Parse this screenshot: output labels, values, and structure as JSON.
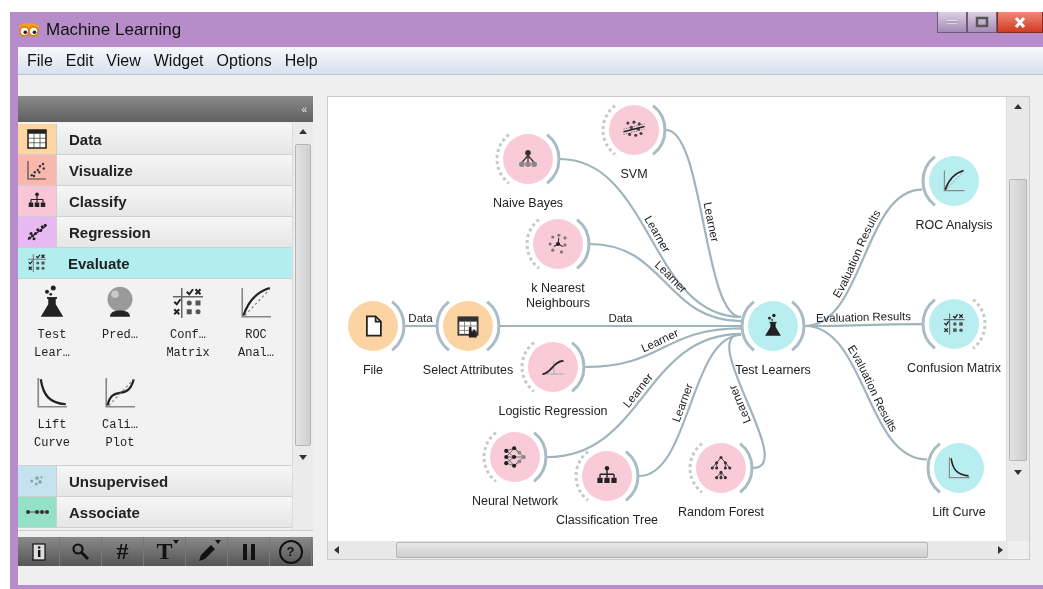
{
  "window": {
    "title": "Machine Learning"
  },
  "menu": [
    {
      "label": "File"
    },
    {
      "label": "Edit"
    },
    {
      "label": "View"
    },
    {
      "label": "Widget"
    },
    {
      "label": "Options"
    },
    {
      "label": "Help"
    }
  ],
  "toolbox": {
    "collapse": "«",
    "categories": [
      {
        "label": "Data",
        "kind": "table",
        "color": "#fcd5a0",
        "expanded": false
      },
      {
        "label": "Visualize",
        "kind": "scatter",
        "color": "#f9b8ae",
        "expanded": false
      },
      {
        "label": "Classify",
        "kind": "tree",
        "color": "#f9c6d8",
        "expanded": false
      },
      {
        "label": "Regression",
        "kind": "regression",
        "color": "#e8b8f2",
        "expanded": false
      },
      {
        "label": "Evaluate",
        "kind": "matrix",
        "color": "#b2eeee",
        "expanded": true,
        "widgets": [
          {
            "label": "Test\nLear…",
            "kind": "flask"
          },
          {
            "label": "Pred…",
            "kind": "ball"
          },
          {
            "label": "Conf…\nMatrix",
            "kind": "matrix"
          },
          {
            "label": "ROC\nAnal…",
            "kind": "roc"
          },
          {
            "label": "Lift\nCurve",
            "kind": "lift"
          },
          {
            "label": "Cali…\nPlot",
            "kind": "calibration"
          }
        ]
      },
      {
        "label": "Unsupervised",
        "kind": "cluster",
        "color": "#c4e3ef",
        "expanded": false
      },
      {
        "label": "Associate",
        "kind": "dots",
        "color": "#93e2c8",
        "expanded": false
      }
    ]
  },
  "toolbar": [
    {
      "kind": "info",
      "dropdown": false
    },
    {
      "kind": "search",
      "dropdown": false
    },
    {
      "kind": "glyph",
      "text": "#",
      "dropdown": false
    },
    {
      "kind": "glyph",
      "text": "T",
      "dropdown": true
    },
    {
      "kind": "pen",
      "dropdown": true
    },
    {
      "kind": "pause",
      "dropdown": false
    },
    {
      "kind": "circled",
      "text": "?",
      "dropdown": false
    }
  ],
  "canvas": {
    "nodes": [
      {
        "label": "File",
        "kind": "file",
        "color": "#fcd3a3",
        "input_open": false,
        "output_open": false
      },
      {
        "label": "Select Attributes",
        "kind": "select",
        "color": "#fcd3a3",
        "input_open": false,
        "output_open": false
      },
      {
        "label": "Naive Bayes",
        "kind": "hierarchy",
        "color": "#f9cbd9",
        "input_open": true,
        "output_open": false
      },
      {
        "label": "SVM",
        "kind": "svm",
        "color": "#f9cbd9",
        "input_open": true,
        "output_open": false
      },
      {
        "label": "k Nearest\nNeighbours",
        "kind": "knn",
        "color": "#f9cbd9",
        "input_open": true,
        "output_open": false
      },
      {
        "label": "Logistic Regression",
        "kind": "sigmoid",
        "color": "#f9cbd9",
        "input_open": true,
        "output_open": false
      },
      {
        "label": "Neural Network",
        "kind": "network",
        "color": "#f9cbd9",
        "input_open": true,
        "output_open": false
      },
      {
        "label": "Classification Tree",
        "kind": "tree",
        "color": "#f9cbd9",
        "input_open": true,
        "output_open": false
      },
      {
        "label": "Random Forest",
        "kind": "forest",
        "color": "#f9cbd9",
        "input_open": true,
        "output_open": false
      },
      {
        "label": "Test Learners",
        "kind": "flask",
        "color": "#b8eef0",
        "input_open": false,
        "output_open": false
      },
      {
        "label": "ROC Analysis",
        "kind": "roc",
        "color": "#b8eef0",
        "input_open": false,
        "output_open": false
      },
      {
        "label": "Confusion Matrix",
        "kind": "matrix",
        "color": "#b8eef0",
        "input_open": false,
        "output_open": true
      },
      {
        "label": "Lift Curve",
        "kind": "lift",
        "color": "#b8eef0",
        "input_open": false,
        "output_open": false
      }
    ],
    "links": [
      {
        "label": "Data"
      },
      {
        "label": "Data"
      },
      {
        "label": "Learner"
      },
      {
        "label": "Learner"
      },
      {
        "label": "Learner"
      },
      {
        "label": "Learner"
      },
      {
        "label": "Learner"
      },
      {
        "label": "Learner"
      },
      {
        "label": "Learner"
      },
      {
        "label": "Evaluation Results"
      },
      {
        "label": "Evaluation Results"
      },
      {
        "label": "Evaluation Results"
      }
    ]
  }
}
